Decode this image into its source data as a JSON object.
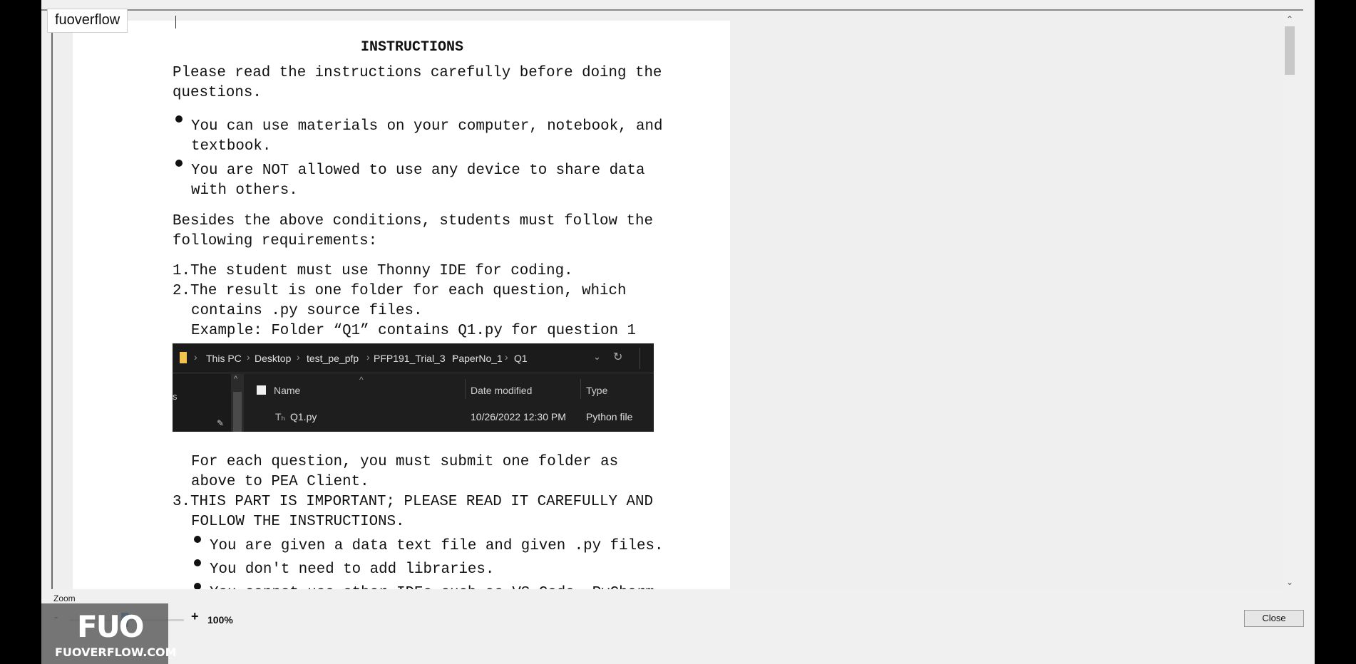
{
  "tooltip": {
    "text": "fuoverflow"
  },
  "document": {
    "title": "INSTRUCTIONS",
    "intro_1": "Please read the instructions carefully before doing the",
    "intro_2": "questions.",
    "bullets": [
      {
        "line1": "You can use materials on your computer, notebook, and",
        "line2": "textbook."
      },
      {
        "line1": "You are NOT allowed to use any device to share data",
        "line2": "with others."
      }
    ],
    "besides_1": "Besides the above conditions, students must follow the",
    "besides_2": "following requirements:",
    "req1": "1.The student must use Thonny IDE for coding.",
    "req2_1": "2.The result is one folder for each question, which",
    "req2_2": "contains .py source files.",
    "req2_3": "Example: Folder “Q1” contains Q1.py for question 1",
    "submit_1": "For each question, you must submit one folder as",
    "submit_2": "above to PEA Client.",
    "req3_1": "3.THIS PART IS IMPORTANT; PLEASE READ IT CAREFULLY AND",
    "req3_2": "FOLLOW THE INSTRUCTIONS.",
    "sub_bullets": [
      "You are given a data text file and given .py files.",
      "You don't need to add libraries.",
      "You cannot use other IDEs such as VS Code, PyCharm,"
    ]
  },
  "explorer": {
    "breadcrumb": [
      "This PC",
      "Desktop",
      "test_pe_pfp",
      "PFP191_Trial_3",
      "PaperNo_1",
      "Q1"
    ],
    "columns": {
      "name": "Name",
      "date": "Date modified",
      "type": "Type"
    },
    "nav_fragment": "s",
    "file": {
      "icon_text": "Tₕ",
      "name": "Q1.py",
      "date": "10/26/2022 12:30 PM",
      "type": "Python file"
    }
  },
  "zoom": {
    "label": "Zoom",
    "minus": "-",
    "plus": "+",
    "value": "100%"
  },
  "close_label": "Close",
  "watermark": {
    "logo": "FUO",
    "site": "FUOVERFLOW.COM"
  },
  "colors": {
    "watermark_bg": "#5f5f5f",
    "zoom_thumb": "#1f74d0",
    "folder": "#f2c14e"
  }
}
